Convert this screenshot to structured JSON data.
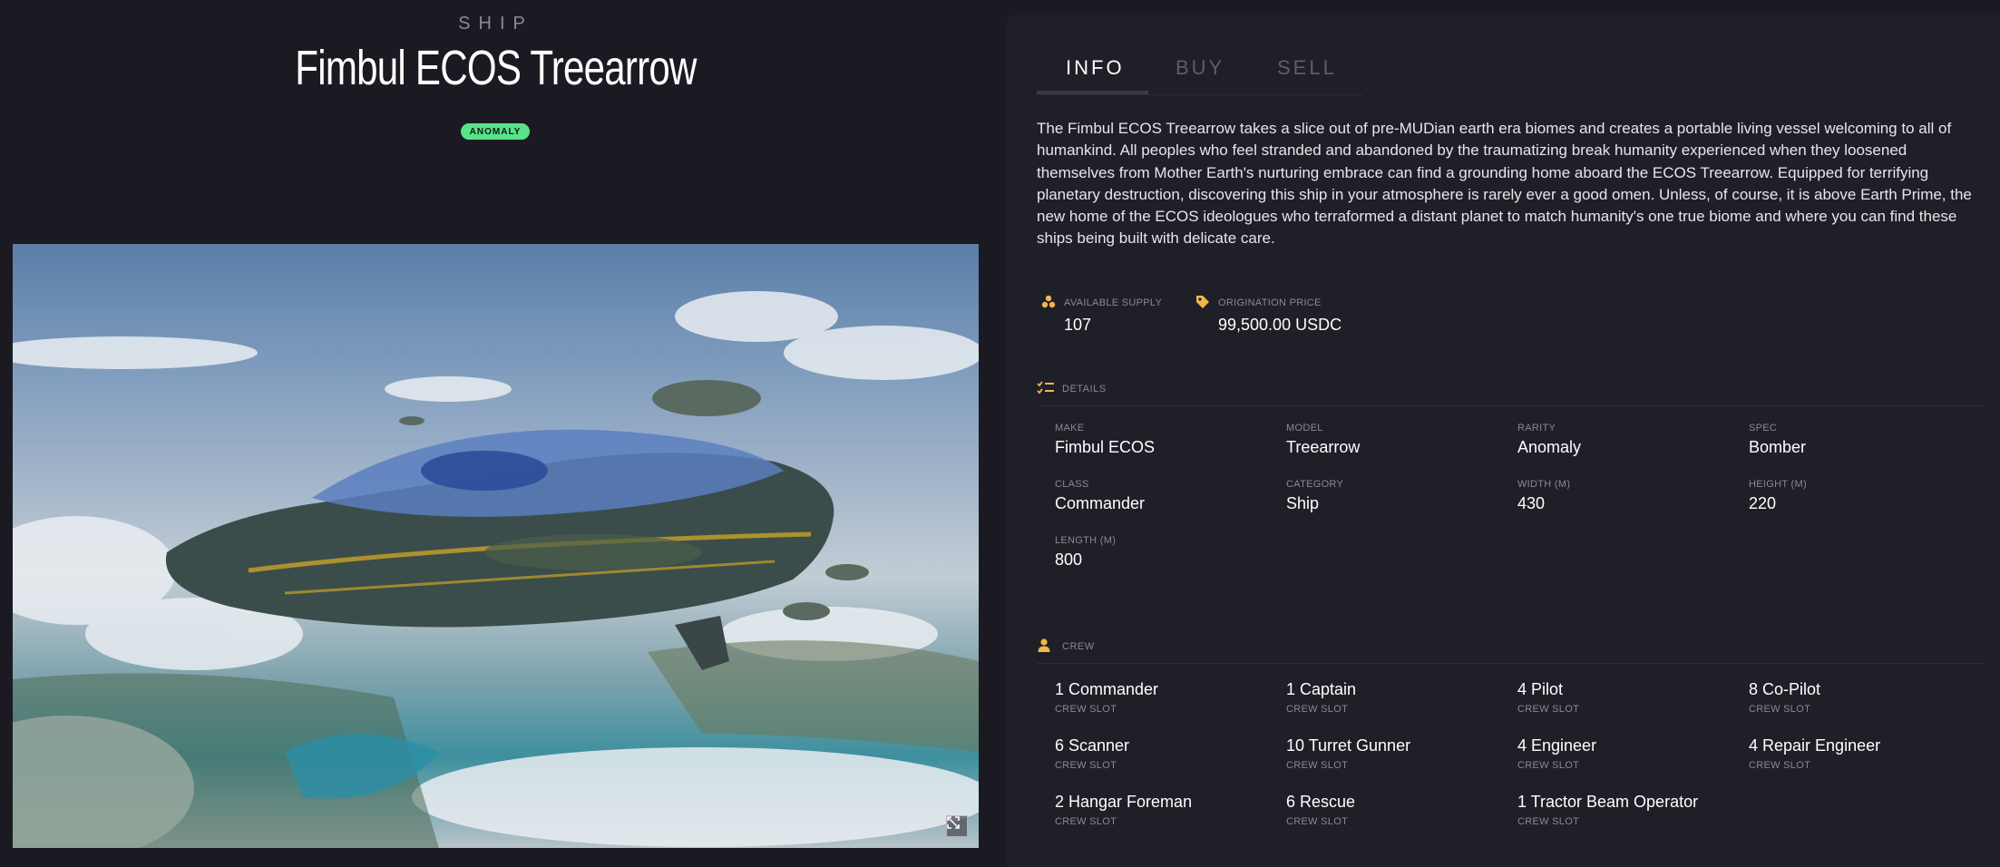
{
  "header": {
    "kicker": "SHIP",
    "title": "Fimbul ECOS Treearrow",
    "rarity_badge": "ANOMALY"
  },
  "colors": {
    "background": "#1b1a22",
    "panel": "#1f1f27",
    "badge": "#57e389",
    "icon_accent": "#f2b64c"
  },
  "tabs": [
    {
      "label": "INFO",
      "active": true
    },
    {
      "label": "BUY",
      "active": false
    },
    {
      "label": "SELL",
      "active": false
    }
  ],
  "description": "The Fimbul ECOS Treearrow takes a slice out of pre-MUDian earth era biomes and creates a portable living vessel welcoming to all of humankind. All peoples who feel stranded and abandoned by the traumatizing break humanity experienced when they loosened themselves from Mother Earth's nurturing embrace can find a grounding home aboard the ECOS Treearrow. Equipped for terrifying planetary destruction, discovering this ship in your atmosphere is rarely ever a good omen. Unless, of course, it is above Earth Prime, the new home of the ECOS ideologues who terraformed a distant planet to match humanity's one true biome and where you can find these ships being built with delicate care.",
  "stats": {
    "supply": {
      "label": "AVAILABLE SUPPLY",
      "value": "107",
      "icon": "coins-stack-icon"
    },
    "price": {
      "label": "ORIGINATION PRICE",
      "value": "99,500.00 USDC",
      "icon": "price-tag-icon"
    }
  },
  "details": {
    "heading": "DETAILS",
    "icon": "checklist-icon",
    "items": [
      {
        "label": "MAKE",
        "value": "Fimbul ECOS"
      },
      {
        "label": "MODEL",
        "value": "Treearrow"
      },
      {
        "label": "RARITY",
        "value": "Anomaly"
      },
      {
        "label": "SPEC",
        "value": "Bomber"
      },
      {
        "label": "CLASS",
        "value": "Commander"
      },
      {
        "label": "CATEGORY",
        "value": "Ship"
      },
      {
        "label": "WIDTH (M)",
        "value": "430"
      },
      {
        "label": "HEIGHT (M)",
        "value": "220"
      },
      {
        "label": "LENGTH (M)",
        "value": "800"
      }
    ]
  },
  "crew": {
    "heading": "CREW",
    "icon": "person-icon",
    "slot_label": "CREW SLOT",
    "items": [
      {
        "name": "1 Commander"
      },
      {
        "name": "1 Captain"
      },
      {
        "name": "4 Pilot"
      },
      {
        "name": "8 Co-Pilot"
      },
      {
        "name": "6 Scanner"
      },
      {
        "name": "10 Turret Gunner"
      },
      {
        "name": "4 Engineer"
      },
      {
        "name": "4 Repair Engineer"
      },
      {
        "name": "2 Hangar Foreman"
      },
      {
        "name": "6 Rescue"
      },
      {
        "name": "1 Tractor Beam Operator"
      }
    ]
  },
  "image": {
    "expand_icon": "expand-icon"
  }
}
